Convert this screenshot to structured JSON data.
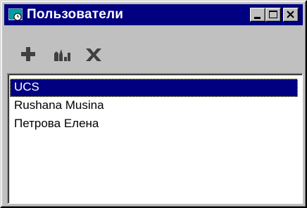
{
  "window": {
    "title": "Пользователи",
    "icon": "users-window-icon"
  },
  "titlebar_buttons": [
    {
      "name": "minimize",
      "icon": "minimize-icon"
    },
    {
      "name": "maximize",
      "icon": "maximize-icon"
    },
    {
      "name": "close",
      "icon": "close-icon"
    }
  ],
  "toolbar": {
    "tools": [
      {
        "name": "add",
        "icon": "plus-icon"
      },
      {
        "name": "edit",
        "icon": "edit-user-icon"
      },
      {
        "name": "delete",
        "icon": "delete-x-icon"
      }
    ]
  },
  "users": {
    "items": [
      "UCS",
      "Rushana Musina",
      "Петрова Елена"
    ],
    "selected_index": 0
  },
  "colors": {
    "titlebar": "#000080",
    "window_face": "#c0c0c0",
    "selection": "#000080",
    "list_background": "#ffffff",
    "toolbar_icon": "#404040"
  }
}
